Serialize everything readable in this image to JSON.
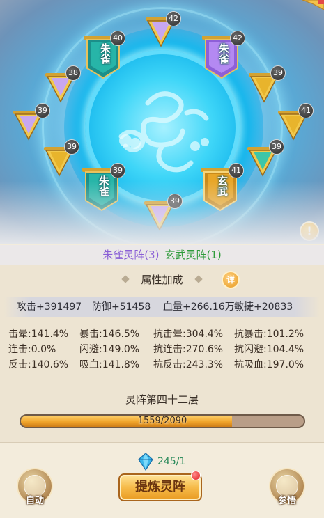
{
  "array": {
    "banners": [
      {
        "id": "top",
        "glyph": "",
        "level": "42",
        "theme": "gold-purple"
      },
      {
        "id": "upper-left",
        "glyph": "朱雀",
        "level": "40",
        "theme": "zhuque-teal"
      },
      {
        "id": "upper-right",
        "glyph": "朱雀",
        "level": "42",
        "theme": "zhuque-purple"
      },
      {
        "id": "left-1",
        "glyph": "",
        "level": "38",
        "theme": "gold-purple"
      },
      {
        "id": "right-1",
        "glyph": "",
        "level": "39",
        "theme": "gold"
      },
      {
        "id": "left-2",
        "glyph": "",
        "level": "39",
        "theme": "gold-purple"
      },
      {
        "id": "right-2",
        "glyph": "",
        "level": "41",
        "theme": "gold"
      },
      {
        "id": "left-3",
        "glyph": "",
        "level": "39",
        "theme": "gold"
      },
      {
        "id": "right-3",
        "glyph": "",
        "level": "39",
        "theme": "gold-teal"
      },
      {
        "id": "lower-left",
        "glyph": "朱雀",
        "level": "39",
        "theme": "zhuque-teal"
      },
      {
        "id": "lower-right",
        "glyph": "玄武",
        "level": "41",
        "theme": "xuanwu-gold"
      },
      {
        "id": "bottom",
        "glyph": "",
        "level": "39",
        "theme": "gold-purple"
      }
    ],
    "alert_symbol": "!"
  },
  "summary": {
    "zhuque": "朱雀灵阵(3)",
    "xuanwu": "玄武灵阵(1)"
  },
  "attributes": {
    "title": "属性加成",
    "detail_label": "详",
    "totals": {
      "attack": "攻击+391497",
      "defense": "防御+51458",
      "hp": "血量+266.16万",
      "agility": "敏捷+20833"
    },
    "rows": [
      [
        "击晕:141.4%",
        "暴击:146.5%",
        "抗击晕:304.4%",
        "抗暴击:101.2%"
      ],
      [
        "连击:0.0%",
        "闪避:149.0%",
        "抗连击:270.6%",
        "抗闪避:104.4%"
      ],
      [
        "反击:140.6%",
        "吸血:141.8%",
        "抗反击:243.3%",
        "抗吸血:197.0%"
      ]
    ]
  },
  "layer": {
    "title": "灵阵第四十二层",
    "progress_text": "1559/2090",
    "current": 1559,
    "max": 2090
  },
  "bottom": {
    "crystal_count": "245/1",
    "auto_label": "自动",
    "refine_label": "提炼灵阵",
    "insight_label": "参悟"
  },
  "colors": {
    "zhuque_text": "#8a5fd6",
    "xuanwu_text": "#2e9b3a",
    "progress_fill": "#f0a52c",
    "crystal": "#2aa6e0"
  }
}
